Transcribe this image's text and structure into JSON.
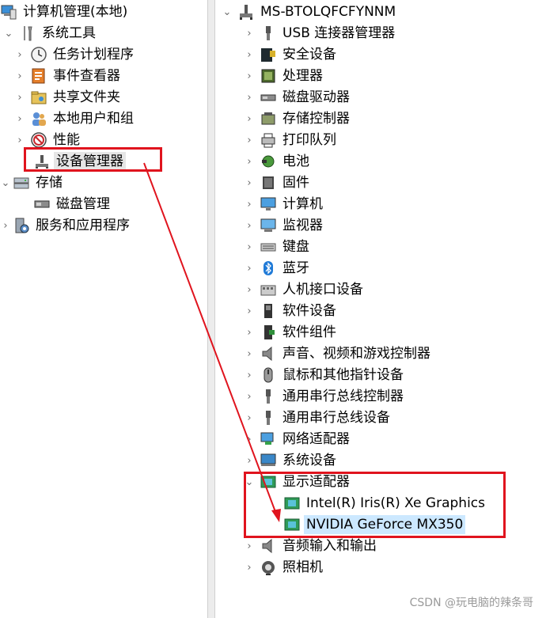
{
  "left_tree": {
    "root": "计算机管理(本地)",
    "system_tools": "系统工具",
    "task_scheduler": "任务计划程序",
    "event_viewer": "事件查看器",
    "shared_folders": "共享文件夹",
    "local_users": "本地用户和组",
    "performance": "性能",
    "device_manager": "设备管理器",
    "storage": "存储",
    "disk_management": "磁盘管理",
    "services_apps": "服务和应用程序"
  },
  "device_tree": {
    "computer": "MS-BTOLQFCFYNNM",
    "categories": [
      "USB 连接器管理器",
      "安全设备",
      "处理器",
      "磁盘驱动器",
      "存储控制器",
      "打印队列",
      "电池",
      "固件",
      "计算机",
      "监视器",
      "键盘",
      "蓝牙",
      "人机接口设备",
      "软件设备",
      "软件组件",
      "声音、视频和游戏控制器",
      "鼠标和其他指针设备",
      "通用串行总线控制器",
      "通用串行总线设备",
      "网络适配器",
      "系统设备",
      "显示适配器"
    ],
    "display_adapters": [
      "Intel(R) Iris(R) Xe Graphics",
      "NVIDIA GeForce MX350"
    ],
    "after": [
      "音频输入和输出",
      "照相机"
    ]
  },
  "watermark": "CSDN @玩电脑的辣条哥",
  "colors": {
    "highlight_box": "#e0141e",
    "selection": "#cce8ff"
  }
}
